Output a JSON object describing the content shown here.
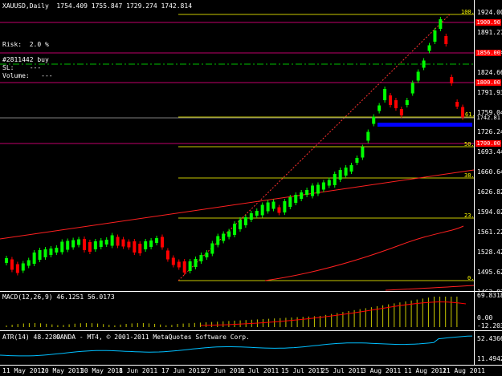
{
  "main": {
    "header": "XAUUSD,Daily  1754.409 1755.847 1729.274 1742.814",
    "risk": "Risk:  2.0 %",
    "order": "#2811442 buy",
    "sl": "SL:    ---",
    "volume": "Volume:   ---"
  },
  "price_axis": [
    "1924.00",
    "1891.27",
    "1858.54",
    "1824.66",
    "1791.93",
    "1759.04",
    "1726.24",
    "1693.44",
    "1660.64",
    "1626.82",
    "1594.02",
    "1561.22",
    "1528.42",
    "1495.62",
    "1462.82"
  ],
  "price_tags": [
    {
      "text": "1900.90",
      "color": "#ff0000"
    },
    {
      "text": "1856.00",
      "color": "#ff0000"
    },
    {
      "text": "1800.00",
      "color": "#ff0000"
    },
    {
      "text": "1742.81",
      "color": "#ffffff"
    },
    {
      "text": "1700.00",
      "color": "#ff0000"
    }
  ],
  "fib_levels": [
    "100.0",
    "61.8",
    "50.0",
    "38.2",
    "23.6",
    "0.0"
  ],
  "macd": {
    "header": "MACD(12,26,9) 46.1251 56.0173",
    "axis_top": "69.8318",
    "axis_bottom": "0.00",
    "axis_neg": "-12.2038"
  },
  "atr": {
    "header": "ATR(14) 48.2289",
    "footer": "OANDA - MT4, © 2001-2011 MetaQuotes Software Corp.",
    "axis_top": "52.4366",
    "axis_bottom": "11.4942"
  },
  "date_axis": [
    "11 May 2011",
    "20 May 2011",
    "30 May 2011",
    "8 Jun 2011",
    "17 Jun 2011",
    "27 Jun 2011",
    "6 Jul 2011",
    "15 Jul 2011",
    "25 Jul 2011",
    "3 Aug 2011",
    "11 Aug 2011",
    "21 Aug 2011"
  ],
  "colors": {
    "bull": "#00ff00",
    "bear": "#ff0000",
    "fib": "#ffff00",
    "hline": "#ff0080",
    "ma": "#ff0000",
    "atr": "#00bfff",
    "macd": "#ffff00"
  }
}
